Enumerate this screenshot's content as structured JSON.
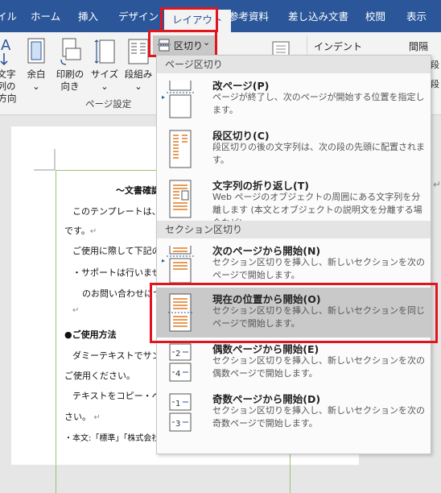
{
  "tabs": [
    {
      "label": "イル"
    },
    {
      "label": "ホーム"
    },
    {
      "label": "挿入"
    },
    {
      "label": "デザイン"
    },
    {
      "label": "レイアウト"
    },
    {
      "label": "参考資料"
    },
    {
      "label": "差し込み文書"
    },
    {
      "label": "校閲"
    },
    {
      "label": "表示"
    }
  ],
  "ribbon": {
    "buttons": [
      {
        "label1": "文字列の",
        "label2": "方向"
      },
      {
        "label1": "余白",
        "label2": ""
      },
      {
        "label1": "印刷の",
        "label2": "向き"
      },
      {
        "label1": "サイズ",
        "label2": ""
      },
      {
        "label1": "段組み",
        "label2": ""
      }
    ],
    "breaks_button": "区切り",
    "indent_label": "インデント",
    "spacing_label": "間隔",
    "group_label": "ページ設定",
    "clipped_right_1": "段",
    "clipped_right_2": "段"
  },
  "menu": {
    "section1": "ページ区切り",
    "section2": "セクション区切り",
    "items": [
      {
        "title": "改ページ(P)",
        "desc": "ページが終了し、次のページが開始する位置を指定します。"
      },
      {
        "title": "段区切り(C)",
        "desc": "段区切りの後の文字列は、次の段の先頭に配置されます。"
      },
      {
        "title": "文字列の折り返し(T)",
        "desc": "Web ページのオブジェクトの周囲にある文字列を分離します (本文とオブジェクトの説明文を分離する場合など)。"
      },
      {
        "title": "次のページから開始(N)",
        "desc": "セクション区切りを挿入し、新しいセクションを次のページで開始します。"
      },
      {
        "title": "現在の位置から開始(O)",
        "desc": "セクション区切りを挿入し、新しいセクションを同じページで開始します。"
      },
      {
        "title": "偶数ページから開始(E)",
        "desc": "セクション区切りを挿入し、新しいセクションを次の偶数ページで開始します。"
      },
      {
        "title": "奇数ページから開始(D)",
        "desc": "セクション区切りを挿入し、新しいセクションを次の奇数ページで開始します。"
      }
    ]
  },
  "document": {
    "lines": [
      "〜文書確認",
      "このテンプレートは、入",
      "です。",
      "ご使用に際して下記の点",
      "・サポートは行いません",
      "のお問い合わせにつきま",
      "●ご使用方法",
      "ダミーテキストでサンプル",
      "ご使用ください。",
      "テキストをコピー・ペースト",
      "さい。",
      "・本文:「標準」「株式会社インク年間」本文」"
    ],
    "para_mark": "↵"
  },
  "colors": {
    "accent": "#2b579a",
    "highlight": "#e0161e",
    "selected_item": "#c9c9c9"
  }
}
